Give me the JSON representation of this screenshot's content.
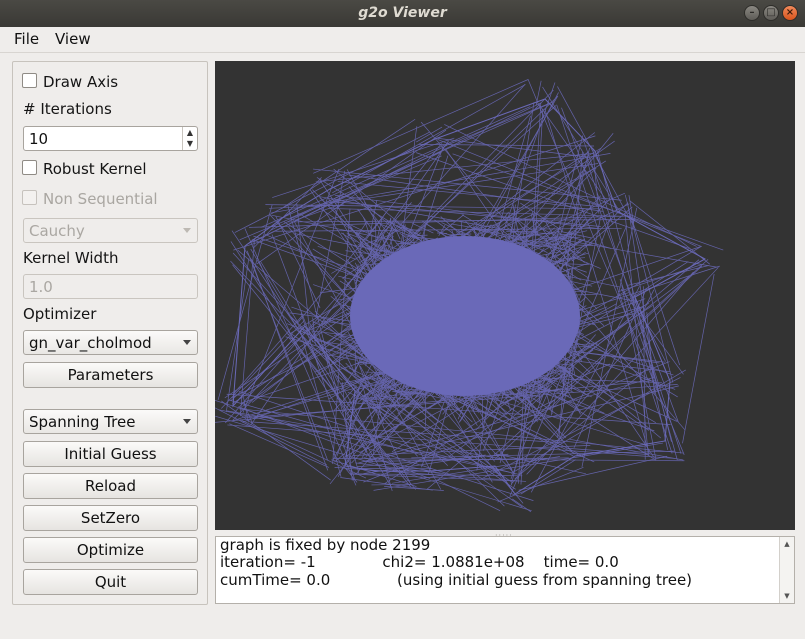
{
  "window": {
    "title": "g2o Viewer"
  },
  "menu": [
    "File",
    "View"
  ],
  "panel": {
    "draw_axis": "Draw Axis",
    "iterations_label": "# Iterations",
    "iterations_value": "10",
    "robust_kernel": "Robust Kernel",
    "non_sequential": "Non Sequential",
    "kernel_type": "Cauchy",
    "kernel_width_label": "Kernel Width",
    "kernel_width_value": "1.0",
    "optimizer_label": "Optimizer",
    "optimizer_value": "gn_var_cholmod",
    "parameters_button": "Parameters",
    "initial_guess_type": "Spanning Tree",
    "initial_guess_button": "Initial Guess",
    "reload_button": "Reload",
    "setzero_button": "SetZero",
    "optimize_button": "Optimize",
    "quit_button": "Quit"
  },
  "console": {
    "lines": [
      "graph is fixed by node 2199",
      "iteration= -1              chi2= 1.0881e+08    time= 0.0",
      "cumTime= 0.0              (using initial guess from spanning tree)"
    ]
  },
  "colors": {
    "graph": "#6a69b8",
    "viewer_bg": "#333333"
  }
}
